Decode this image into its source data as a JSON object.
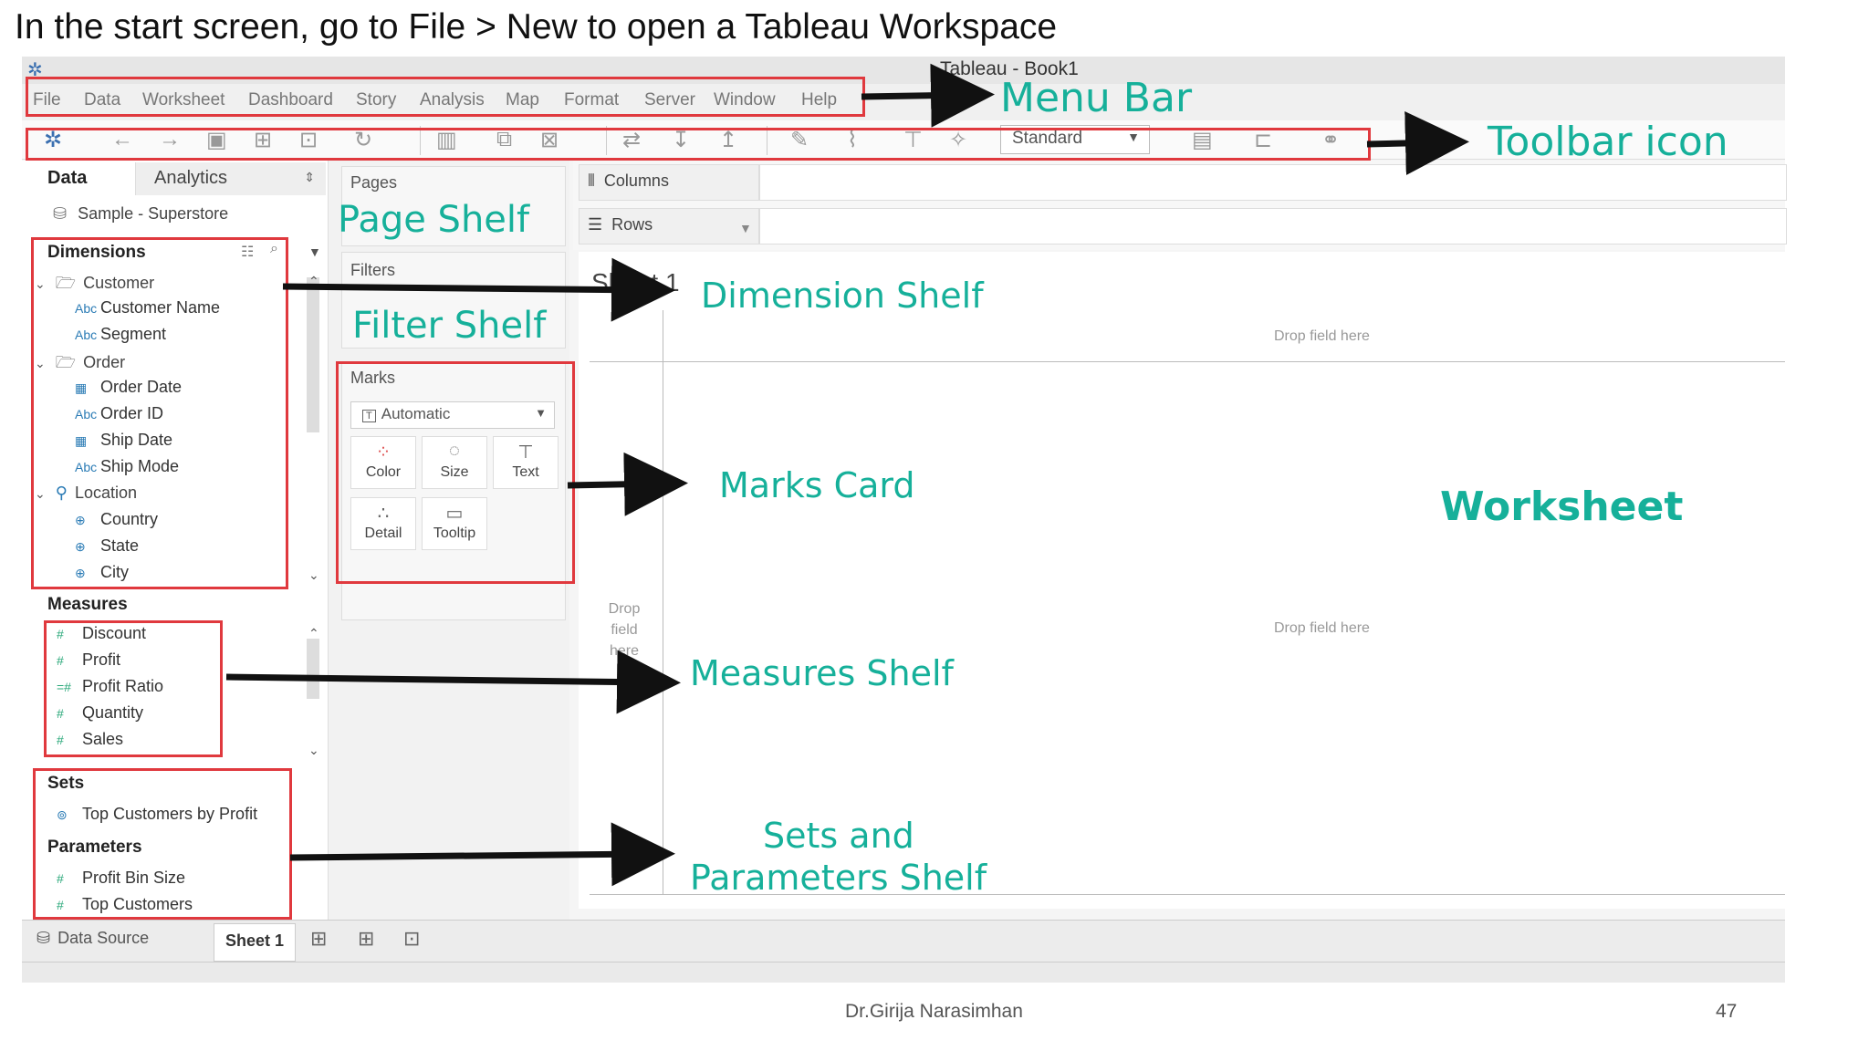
{
  "slide": {
    "title": "In the start screen, go to File > New to open a Tableau Workspace",
    "author": "Dr.Girija Narasimhan",
    "page_number": "47"
  },
  "window": {
    "title": "Tableau - Book1"
  },
  "menu": [
    "File",
    "Data",
    "Worksheet",
    "Dashboard",
    "Story",
    "Analysis",
    "Map",
    "Format",
    "Server",
    "Window",
    "Help"
  ],
  "toolbar": {
    "fit_select": "Standard"
  },
  "left_panel": {
    "tab_data": "Data",
    "tab_analytics": "Analytics",
    "data_source": "Sample - Superstore",
    "dimensions_header": "Dimensions",
    "dimension_items": [
      {
        "label": "Customer",
        "type": "folder"
      },
      {
        "label": "Customer Name",
        "type": "abc"
      },
      {
        "label": "Segment",
        "type": "abc"
      },
      {
        "label": "Order",
        "type": "folder"
      },
      {
        "label": "Order Date",
        "type": "date"
      },
      {
        "label": "Order ID",
        "type": "abc"
      },
      {
        "label": "Ship Date",
        "type": "date"
      },
      {
        "label": "Ship Mode",
        "type": "abc"
      },
      {
        "label": "Location",
        "type": "hierarchy"
      },
      {
        "label": "Country",
        "type": "globe"
      },
      {
        "label": "State",
        "type": "globe"
      },
      {
        "label": "City",
        "type": "globe"
      }
    ],
    "abc_label": "Abc",
    "measures_header": "Measures",
    "measure_items": [
      "Discount",
      "Profit",
      "Profit Ratio",
      "Quantity",
      "Sales"
    ],
    "sets_header": "Sets",
    "set_items": [
      "Top Customers by Profit"
    ],
    "parameters_header": "Parameters",
    "parameter_items": [
      "Profit Bin Size",
      "Top Customers"
    ]
  },
  "middle_panel": {
    "pages_label": "Pages",
    "filters_label": "Filters",
    "marks_label": "Marks",
    "marks_type": "Automatic",
    "mark_buttons": [
      "Color",
      "Size",
      "Text",
      "Detail",
      "Tooltip"
    ]
  },
  "shelves": {
    "columns": "Columns",
    "rows": "Rows"
  },
  "worksheet": {
    "sheet_title": "Sheet 1",
    "drop_hint": "Drop field here",
    "drop_hint_left": [
      "Drop",
      "field",
      "here"
    ]
  },
  "bottom_tabs": {
    "data_source": "Data Source",
    "sheet": "Sheet 1"
  },
  "annotations": {
    "menu_bar": "Menu Bar",
    "toolbar_icon": "Toolbar icon",
    "page_shelf": "Page Shelf",
    "filter_shelf": "Filter Shelf",
    "dimension_shelf": "Dimension Shelf",
    "marks_card": "Marks Card",
    "worksheet": "Worksheet",
    "measures_shelf": "Measures Shelf",
    "sets_params_line1": "Sets and",
    "sets_params_line2": "Parameters Shelf"
  },
  "colors": {
    "annotation": "#16b09a",
    "highlight_box": "#e0393e",
    "field_blue": "#2a7bb5",
    "field_green": "#2aa87a"
  }
}
